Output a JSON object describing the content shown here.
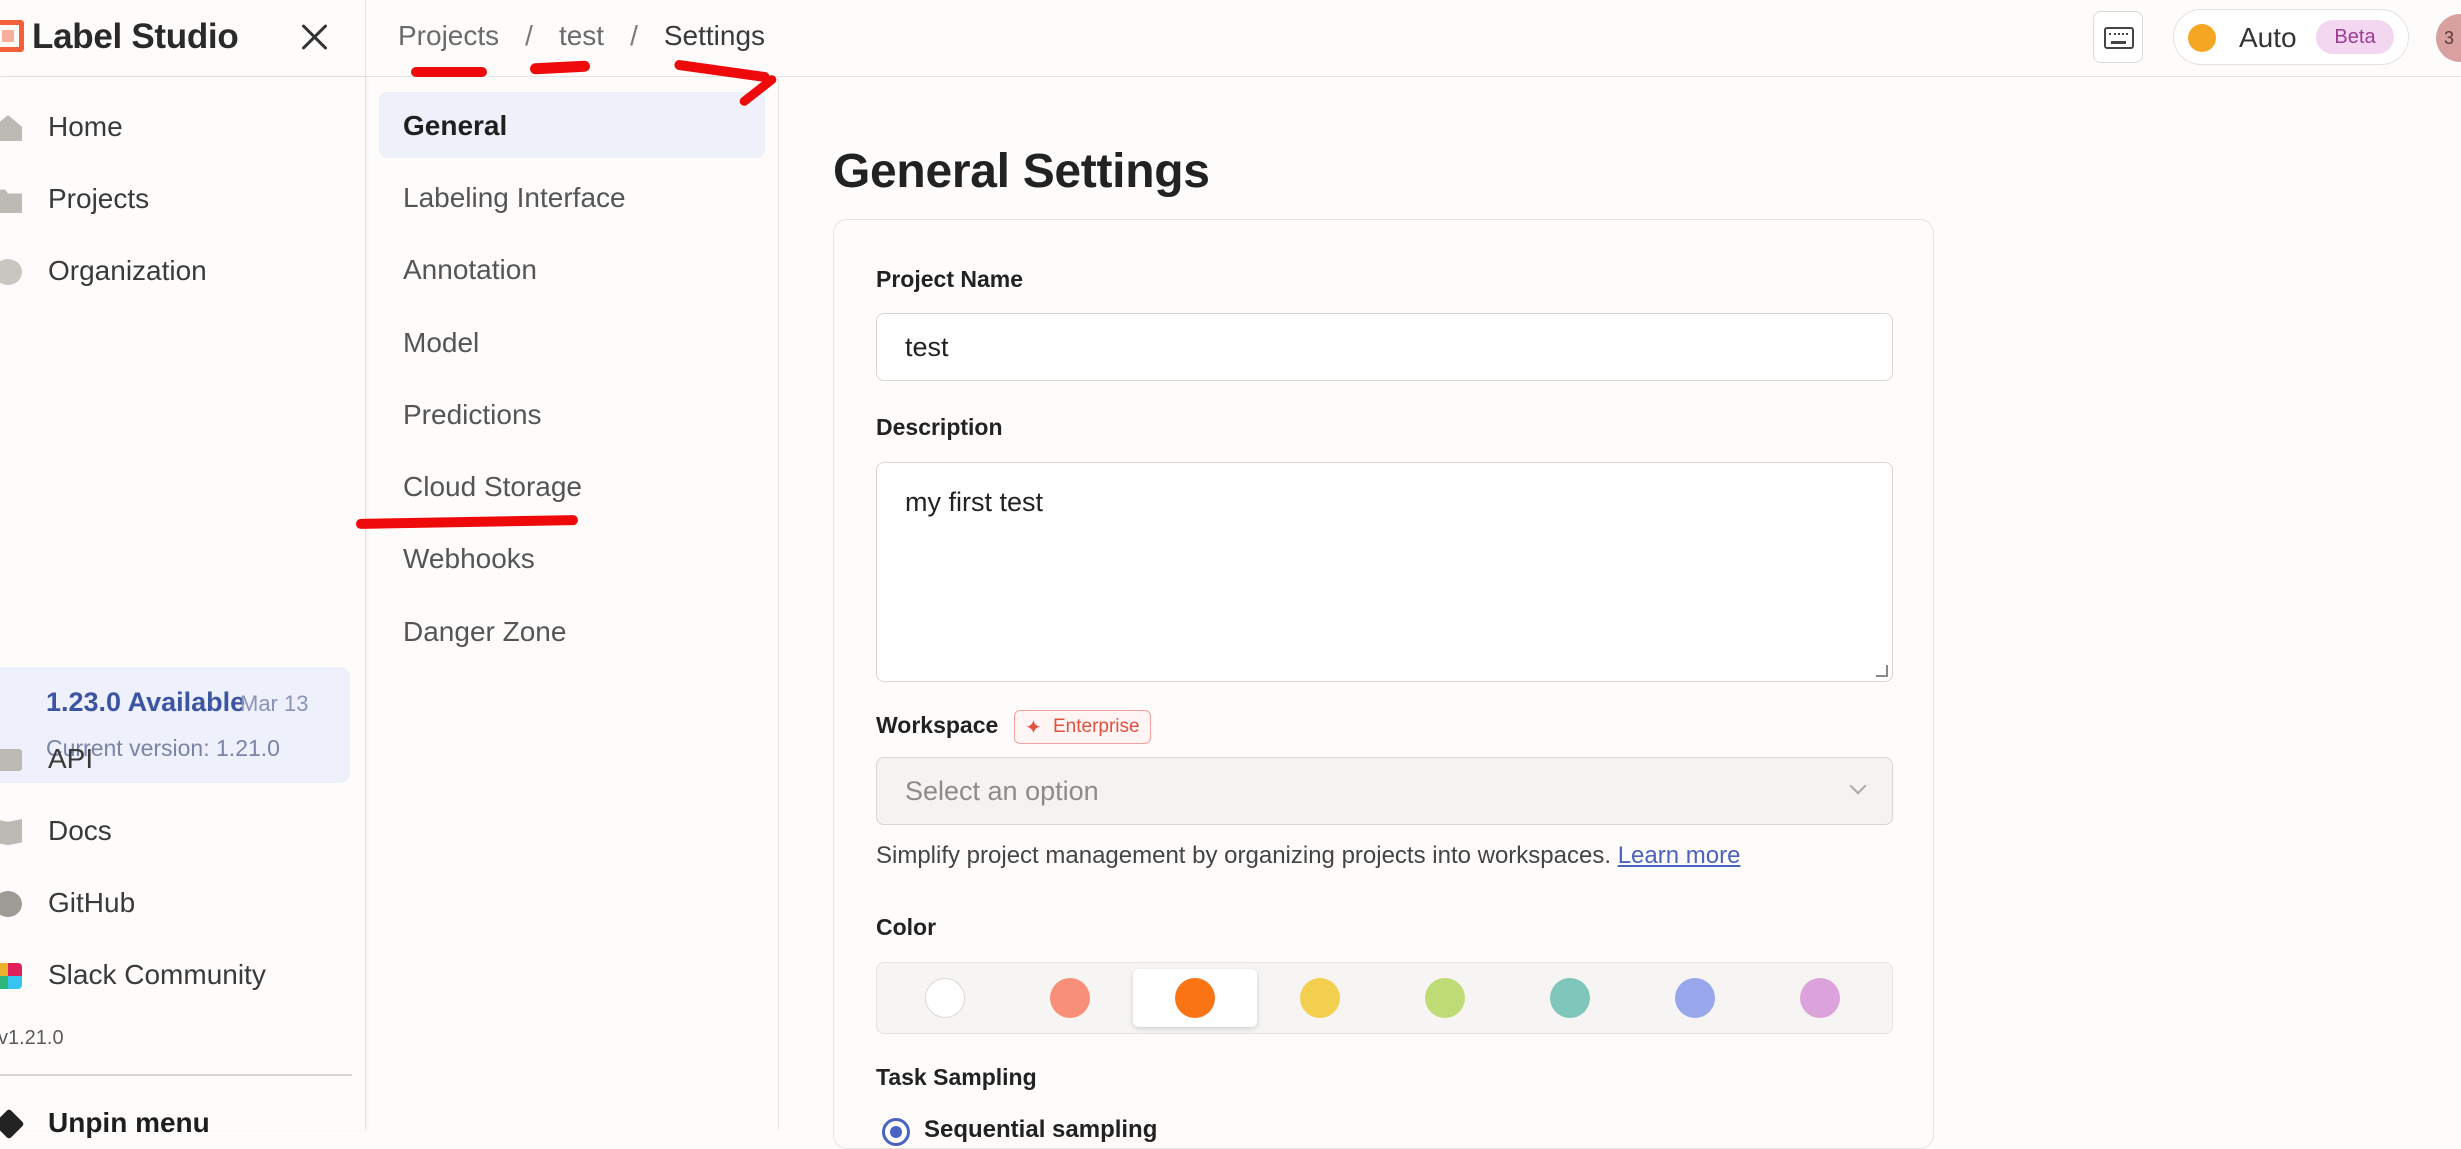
{
  "app": {
    "name": "Label Studio"
  },
  "breadcrumb": {
    "items": [
      "Projects",
      "test",
      "Settings"
    ],
    "separator": "/"
  },
  "header": {
    "theme_label": "Auto",
    "beta_label": "Beta",
    "avatar_initial": "3"
  },
  "sidebar": {
    "items": [
      {
        "label": "Home",
        "icon": "home-icon"
      },
      {
        "label": "Projects",
        "icon": "folder-icon"
      },
      {
        "label": "Organization",
        "icon": "user-icon"
      },
      {
        "label": "API",
        "icon": "api-icon"
      },
      {
        "label": "Docs",
        "icon": "docs-icon"
      },
      {
        "label": "GitHub",
        "icon": "github-icon"
      },
      {
        "label": "Slack Community",
        "icon": "slack-icon"
      }
    ],
    "update": {
      "title": "1.23.0 Available",
      "date": "Mar 13",
      "current": "Current version: 1.21.0"
    },
    "version": "v1.21.0",
    "unpin_label": "Unpin menu"
  },
  "settings_menu": {
    "items": [
      "General",
      "Labeling Interface",
      "Annotation",
      "Model",
      "Predictions",
      "Cloud Storage",
      "Webhooks",
      "Danger Zone"
    ],
    "active": "General"
  },
  "main": {
    "title": "General Settings",
    "project_name_label": "Project Name",
    "project_name_value": "test",
    "description_label": "Description",
    "description_value": "my first test",
    "workspace_label": "Workspace",
    "enterprise_badge": "Enterprise",
    "workspace_placeholder": "Select an option",
    "help_text": "Simplify project management by organizing projects into workspaces.",
    "help_link": "Learn more",
    "color_label": "Color",
    "colors": [
      "#ffffff",
      "#f88f78",
      "#fa7413",
      "#f2cf4f",
      "#bfdb75",
      "#7fc6bb",
      "#98a7eb",
      "#dca2dc"
    ],
    "selected_color_index": 2,
    "task_sampling_label": "Task Sampling",
    "sampling_option": "Sequential sampling"
  }
}
